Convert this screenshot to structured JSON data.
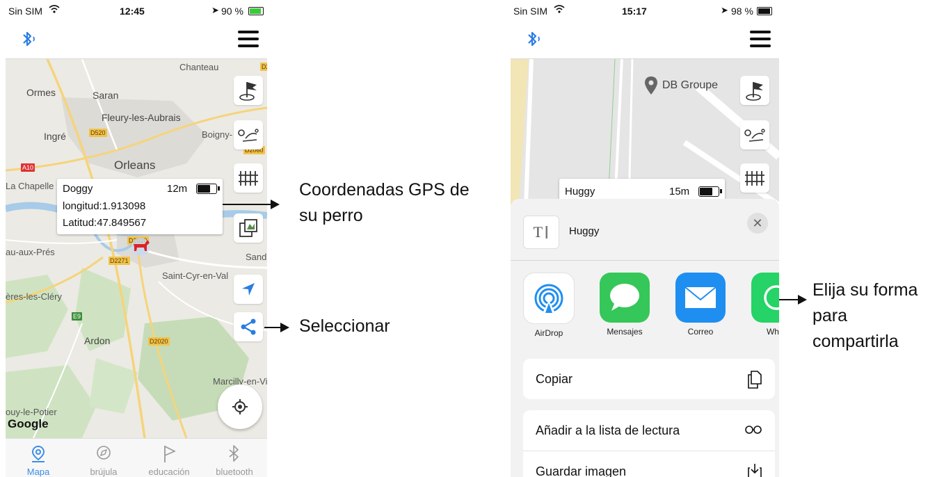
{
  "phone1": {
    "status": {
      "carrier": "Sin SIM",
      "time": "12:45",
      "battery": "90 %"
    },
    "map": {
      "labels": [
        "Chanteau",
        "Ormes",
        "Saran",
        "Fleury-les-Aubrais",
        "Ingré",
        "Boigny-",
        "Orleans",
        "La Chapelle",
        "au-aux-Prés",
        "Sandil",
        "Saint-Cyr-en-Val",
        "ères-les-Cléry",
        "Ardon",
        "Marcilly-en-Vi",
        "ouy-le-Potier"
      ],
      "roads": [
        "D2",
        "D520",
        "D2060",
        "A10",
        "D2020",
        "D2271",
        "E9",
        "D2020"
      ],
      "google": "Google"
    },
    "device": {
      "name": "Doggy",
      "distance": "12m",
      "longitude": "longitud:1.913098",
      "latitude": "Latitud:47.849567"
    },
    "tabs": [
      {
        "label": "Mapa",
        "icon": "map-pin-icon"
      },
      {
        "label": "brújula",
        "icon": "compass-icon"
      },
      {
        "label": "educación",
        "icon": "flag-icon"
      },
      {
        "label": "bluetooth",
        "icon": "bluetooth-icon"
      }
    ]
  },
  "phone2": {
    "status": {
      "carrier": "Sin SIM",
      "time": "15:17",
      "battery": "98 %"
    },
    "map": {
      "poi": "DB Groupe"
    },
    "device": {
      "name": "Huggy",
      "distance": "15m"
    },
    "sheet": {
      "title": "Huggy",
      "apps": [
        "AirDrop",
        "Mensajes",
        "Correo",
        "What"
      ],
      "actions": [
        "Copiar",
        "Añadir a la lista de lectura",
        "Guardar imagen"
      ]
    }
  },
  "annotations": {
    "gps_line1": "Coordenadas GPS de",
    "gps_line2": "su perro",
    "select": "Seleccionar",
    "share_line1": "Elija su forma",
    "share_line2": "para",
    "share_line3": "compartirla"
  },
  "colors": {
    "accent": "#3b8ee8",
    "messages": "#35c759",
    "mail": "#1f8ef1",
    "whatsapp": "#25d366"
  }
}
